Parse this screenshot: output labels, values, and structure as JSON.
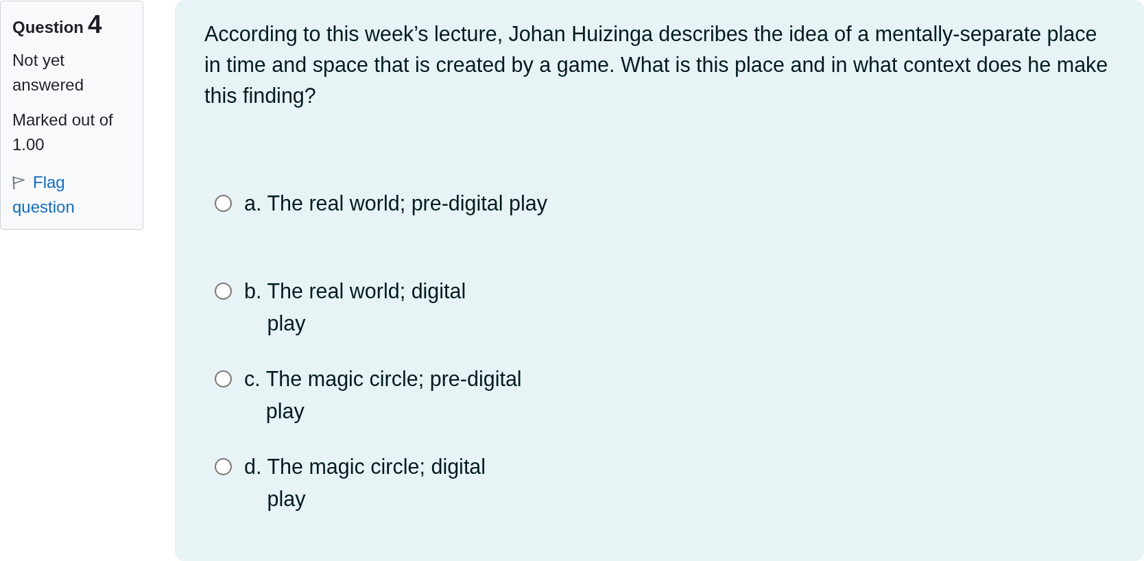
{
  "question_info": {
    "label": "Question",
    "number": "4",
    "status": "Not yet answered",
    "grade": "Marked out of 1.00",
    "flag_link": "Flag question",
    "flagged": false
  },
  "question": {
    "text": "According to this week’s lecture, Johan Huizinga describes the idea of a mentally-separate place in time and space that is created by a game. What is this place and in what context does he make this finding?"
  },
  "options": [
    {
      "letter": "a.",
      "text": "The real world; pre-digital play",
      "selected": false
    },
    {
      "letter": "b.",
      "text": "The real world; digital\nplay",
      "selected": false
    },
    {
      "letter": "c.",
      "text": "The magic circle; pre-digital\nplay",
      "selected": false
    },
    {
      "letter": "d.",
      "text": "The magic circle; digital\nplay",
      "selected": false
    }
  ]
}
